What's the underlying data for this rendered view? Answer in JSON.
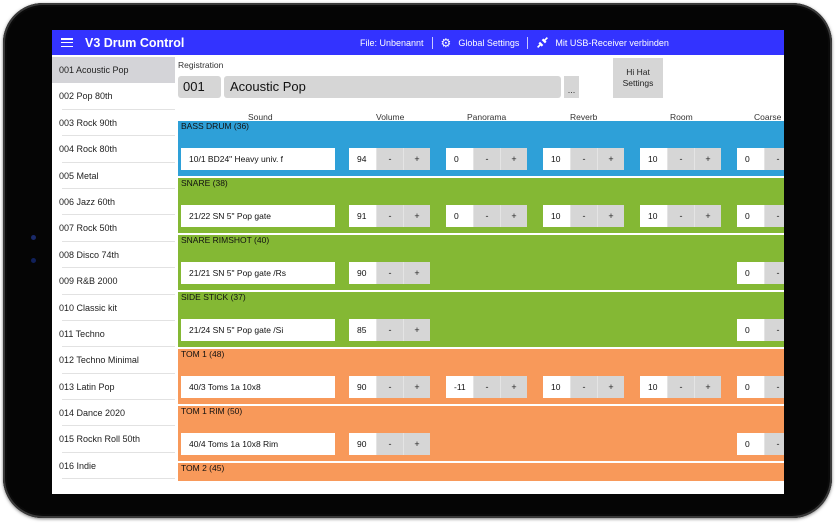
{
  "appbar": {
    "title": "V3 Drum Control",
    "file_label": "File: Unbenannt",
    "global_settings": "Global Settings",
    "usb_connect": "Mit USB-Receiver verbinden",
    "color": "#3333ff"
  },
  "sidebar": {
    "presets": [
      {
        "label": "001 Acoustic Pop",
        "active": true
      },
      {
        "label": "002 Pop 80th"
      },
      {
        "label": "003 Rock 90th"
      },
      {
        "label": "004 Rock 80th"
      },
      {
        "label": "005 Metal"
      },
      {
        "label": "006 Jazz 60th"
      },
      {
        "label": "007 Rock 50th"
      },
      {
        "label": "008 Disco 74th"
      },
      {
        "label": "009 R&B 2000"
      },
      {
        "label": "010 Classic kit"
      },
      {
        "label": "011 Techno"
      },
      {
        "label": "012 Techno Minimal"
      },
      {
        "label": "013 Latin Pop"
      },
      {
        "label": "014 Dance 2020"
      },
      {
        "label": "015 Rockn Roll 50th"
      },
      {
        "label": "016 Indie"
      }
    ]
  },
  "registration": {
    "label": "Registration",
    "number": "001",
    "name": "Acoustic Pop",
    "more_button": "...",
    "hihat_button_line1": "Hi Hat",
    "hihat_button_line2": "Settings"
  },
  "columns": {
    "sound": "Sound",
    "volume": "Volume",
    "panorama": "Panorama",
    "reverb": "Reverb",
    "room": "Room",
    "coarse": "Coarse"
  },
  "stepper": {
    "minus": "-",
    "plus": "+"
  },
  "colors": {
    "blue": "#2ea0d8",
    "green": "#84b834",
    "orange": "#f8995a"
  },
  "instruments": [
    {
      "label": "BASS DRUM (36)",
      "color": "#2ea0d8",
      "sound": "10/1 BD24\" Heavy  univ.  f",
      "volume": "94",
      "panorama": "0",
      "reverb": "10",
      "room": "10",
      "coarse": "0"
    },
    {
      "label": "SNARE (38)",
      "color": "#84b834",
      "sound": "21/22  SN 5\"  Pop  gate",
      "volume": "91",
      "panorama": "0",
      "reverb": "10",
      "room": "10",
      "coarse": "0"
    },
    {
      "label": "SNARE RIMSHOT (40)",
      "color": "#84b834",
      "sound": "21/21  SN 5\"  Pop  gate  /Rs",
      "volume": "90",
      "coarse": "0"
    },
    {
      "label": "SIDE STICK (37)",
      "color": "#84b834",
      "sound": "21/24  SN 5\"  Pop  gate  /Si",
      "volume": "85",
      "coarse": "0"
    },
    {
      "label": "TOM 1 (48)",
      "color": "#f8995a",
      "sound": "40/3  Toms 1a  10x8",
      "volume": "90",
      "panorama": "-11",
      "reverb": "10",
      "room": "10",
      "coarse": "0"
    },
    {
      "label": "TOM 1 RIM (50)",
      "color": "#f8995a",
      "sound": "40/4  Toms 1a  10x8 Rim",
      "volume": "90",
      "coarse": "0"
    },
    {
      "label": "TOM 2 (45)",
      "color": "#f8995a"
    }
  ]
}
